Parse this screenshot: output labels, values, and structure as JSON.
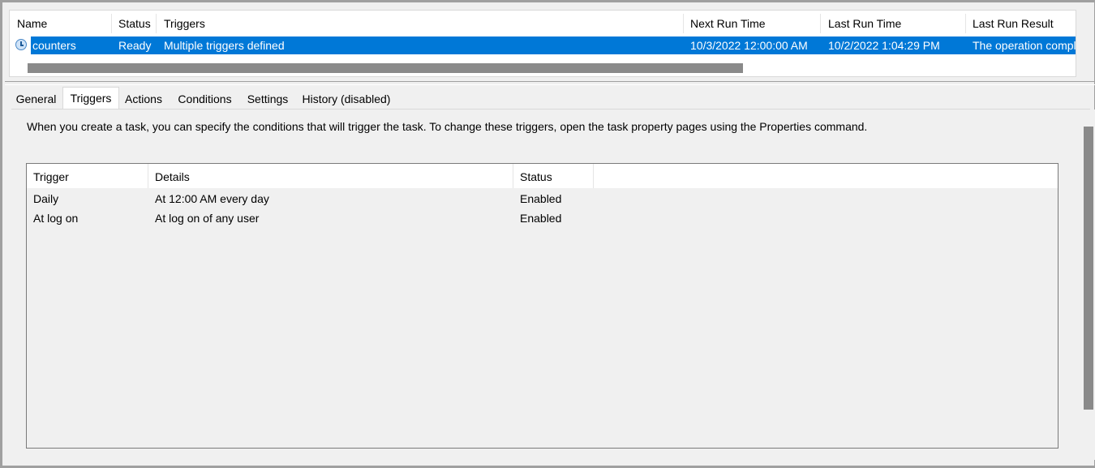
{
  "tasklist": {
    "columns": [
      "Name",
      "Status",
      "Triggers",
      "Next Run Time",
      "Last Run Time",
      "Last Run Result"
    ],
    "rows": [
      {
        "name": "counters",
        "status": "Ready",
        "triggers": "Multiple triggers defined",
        "next_run": "10/3/2022 12:00:00 AM",
        "last_run": "10/2/2022 1:04:29 PM",
        "last_result": "The operation completed successfully."
      }
    ]
  },
  "tabs": [
    "General",
    "Triggers",
    "Actions",
    "Conditions",
    "Settings",
    "History (disabled)"
  ],
  "active_tab": "Triggers",
  "triggers_panel": {
    "description": "When you create a task, you can specify the conditions that will trigger the task.  To change these triggers, open the task property pages using the Properties command.",
    "columns": [
      "Trigger",
      "Details",
      "Status"
    ],
    "rows": [
      {
        "trigger": "Daily",
        "details": "At 12:00 AM every day",
        "status": "Enabled"
      },
      {
        "trigger": "At log on",
        "details": "At log on of any user",
        "status": "Enabled"
      }
    ]
  },
  "colors": {
    "selection": "#0078d7",
    "scrollbar_thumb": "#8a8a8a",
    "background": "#f0f0f0"
  }
}
